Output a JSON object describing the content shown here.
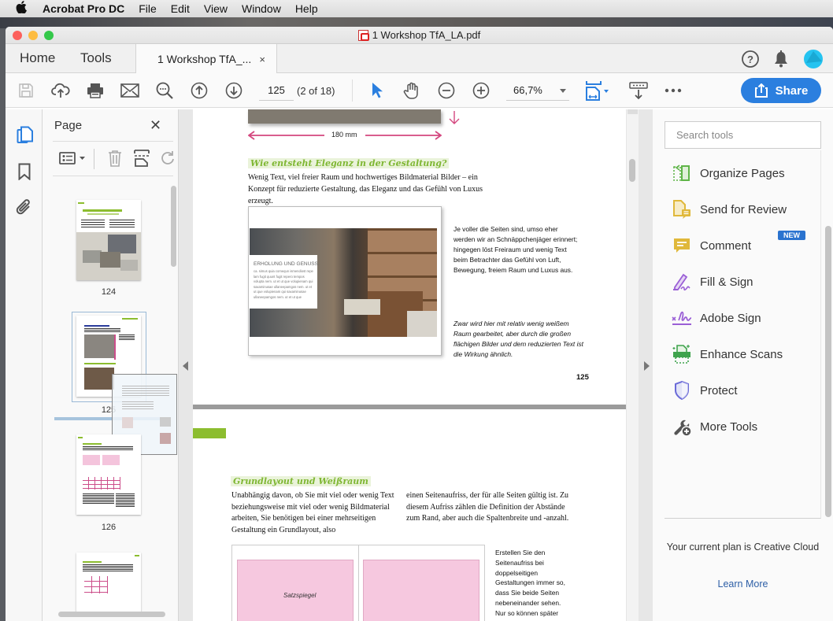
{
  "menubar": {
    "apple": "",
    "app_name": "Acrobat Pro DC",
    "items": [
      "File",
      "Edit",
      "View",
      "Window",
      "Help"
    ]
  },
  "window": {
    "title": "1  Workshop TfA_LA.pdf",
    "traffic_lights": {
      "close": "#fc605c",
      "minimize": "#fdbc40",
      "zoom": "#34c84a"
    }
  },
  "tabs": {
    "home": "Home",
    "tools": "Tools",
    "document_tab": "1  Workshop TfA_...",
    "document_tab_close": "×"
  },
  "header_icons": [
    "help-icon",
    "notifications-bell-icon",
    "user-avatar"
  ],
  "toolbar": {
    "icons": [
      "save-icon",
      "upload-cloud-icon",
      "print-icon",
      "email-icon",
      "find-text-icon",
      "page-up-icon",
      "page-down-icon",
      "select-cursor-icon",
      "hand-tool-icon",
      "zoom-out-icon",
      "zoom-in-icon",
      "fit-page-icon",
      "scroll-mode-icon",
      "more-icon"
    ],
    "page_number": "125",
    "page_count": "(2 of 18)",
    "zoom_level": "66,7%",
    "share_label": "Share",
    "accent": "#2b7fdf"
  },
  "left_rail": {
    "icons": [
      "page-thumbnails-icon",
      "bookmark-icon",
      "attachment-icon"
    ]
  },
  "pages_panel": {
    "title": "Page",
    "close": "✕",
    "thumbnails": [
      {
        "label": "124"
      },
      {
        "label": "125",
        "selected": true
      },
      {
        "label": "126"
      },
      {
        "label": ""
      }
    ]
  },
  "document": {
    "page125": {
      "dimension": "180 mm",
      "heading": "Wie entsteht Eleganz in der Gestaltung?",
      "intro": "Wenig Text, viel freier Raum und hochwertiges Bildmaterial Bilder – ein Konzept für reduzierte Gestaltung, das Eleganz und das Gefühl von Luxus erzeugt.",
      "image_overlay_title": "ERHOLUNG UND GENUSS.",
      "image_overlay_text": "ca. simus quia comequn ismendiost repe lam fugit quunt fugit repero tempos volupta nem. ut et ut que volupienam qui saxaminusae ullaneepamgos nem. ut et ut que volupienam qui saxaminusae ullaneepamgos nem. ut et ut que",
      "side_text": "Je voller die Seiten sind, umso eher werden wir an Schnäppchenjäger erinnert; hingegen löst Freiraum und wenig Text beim Betrachter das Gefühl von Luft, Bewegung, freiem Raum und Luxus aus.",
      "side_italic": "Zwar wird hier mit relativ wenig weißem Raum gearbeitet, aber durch die großen flächigen Bilder und dem reduzierten Text ist die Wirkung ähnlich.",
      "page_number": "125"
    },
    "page126": {
      "heading": "Grundlayout und Weißraum",
      "col1": "Unabhängig davon, ob Sie mit viel oder wenig Text beziehungsweise mit viel oder wenig Bildmaterial arbeiten, Sie benötigen bei einer mehrseitigen Gestaltung ein Grundlayout, also",
      "col2": "einen Seitenaufriss, der für alle Seiten gültig ist. Zu diesem Aufriss zählen die Definition der Abstände zum Rand, aber auch die Spaltenbreite und -anzahl.",
      "diagram_label": "Satzspiegel",
      "side_text": "Erstellen Sie den Seitenaufriss bei doppelseitigen Gestaltungen immer so, dass Sie beide Seiten nebeneinander sehen. Nur so können später auch beide Seiten miteinander harmonieren, wenn"
    }
  },
  "tools_panel": {
    "search_placeholder": "Search tools",
    "items": [
      {
        "label": "Organize Pages",
        "icon": "organize-pages-icon",
        "color": "#5fb548"
      },
      {
        "label": "Send for Review",
        "icon": "send-for-review-icon",
        "color": "#e0b83a",
        "badge": "NEW"
      },
      {
        "label": "Comment",
        "icon": "comment-icon",
        "color": "#e0b83a"
      },
      {
        "label": "Fill & Sign",
        "icon": "fill-sign-icon",
        "color": "#9a5fd6"
      },
      {
        "label": "Adobe Sign",
        "icon": "adobe-sign-icon",
        "color": "#9a5fd6"
      },
      {
        "label": "Enhance Scans",
        "icon": "enhance-scans-icon",
        "color": "#3fa34d"
      },
      {
        "label": "Protect",
        "icon": "protect-shield-icon",
        "color": "#6a6ad8"
      },
      {
        "label": "More Tools",
        "icon": "more-tools-icon",
        "color": "#555555"
      }
    ],
    "plan_text": "Your current plan is Creative Cloud",
    "learn_more": "Learn More"
  }
}
